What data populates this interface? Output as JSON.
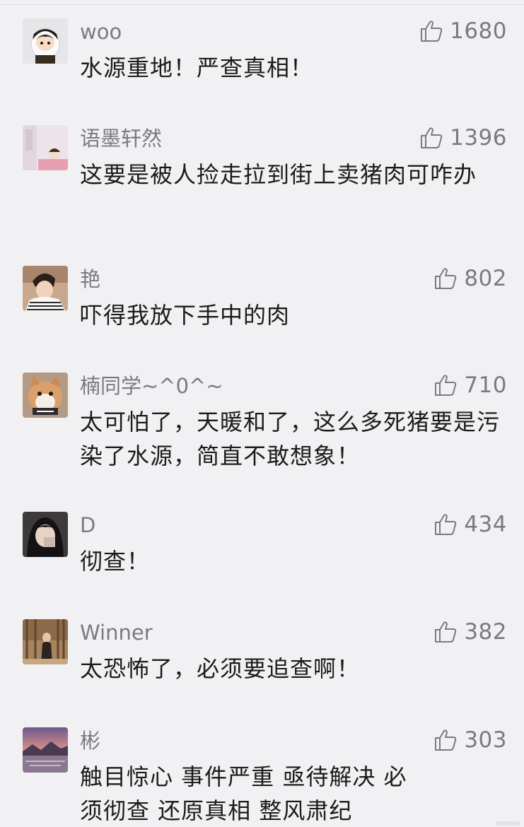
{
  "comments": [
    {
      "username": "woo",
      "likes": "1680",
      "text": "水源重地！严查真相！"
    },
    {
      "username": "语墨轩然",
      "likes": "1396",
      "text": "这要是被人捡走拉到街上卖猪肉可咋办"
    },
    {
      "username": "艳",
      "likes": "802",
      "text": "吓得我放下手中的肉"
    },
    {
      "username": "楠同学~^0^~",
      "likes": "710",
      "text": "太可怕了，天暖和了，这么多死猪要是污染了水源，简直不敢想象！"
    },
    {
      "username": "D",
      "likes": "434",
      "text": "彻查！"
    },
    {
      "username": "Winner",
      "likes": "382",
      "text": "太恐怖了，必须要追查啊！"
    },
    {
      "username": "彬",
      "likes": "303",
      "text": "触目惊心  事件严重  亟待解决 必须彻查  还原真相  整风肃纪"
    }
  ],
  "icons": {
    "like": "thumbs-up-icon"
  },
  "colors": {
    "background": "#f1f1f3",
    "meta": "#7b7b7f",
    "text": "#1b1b1b"
  }
}
